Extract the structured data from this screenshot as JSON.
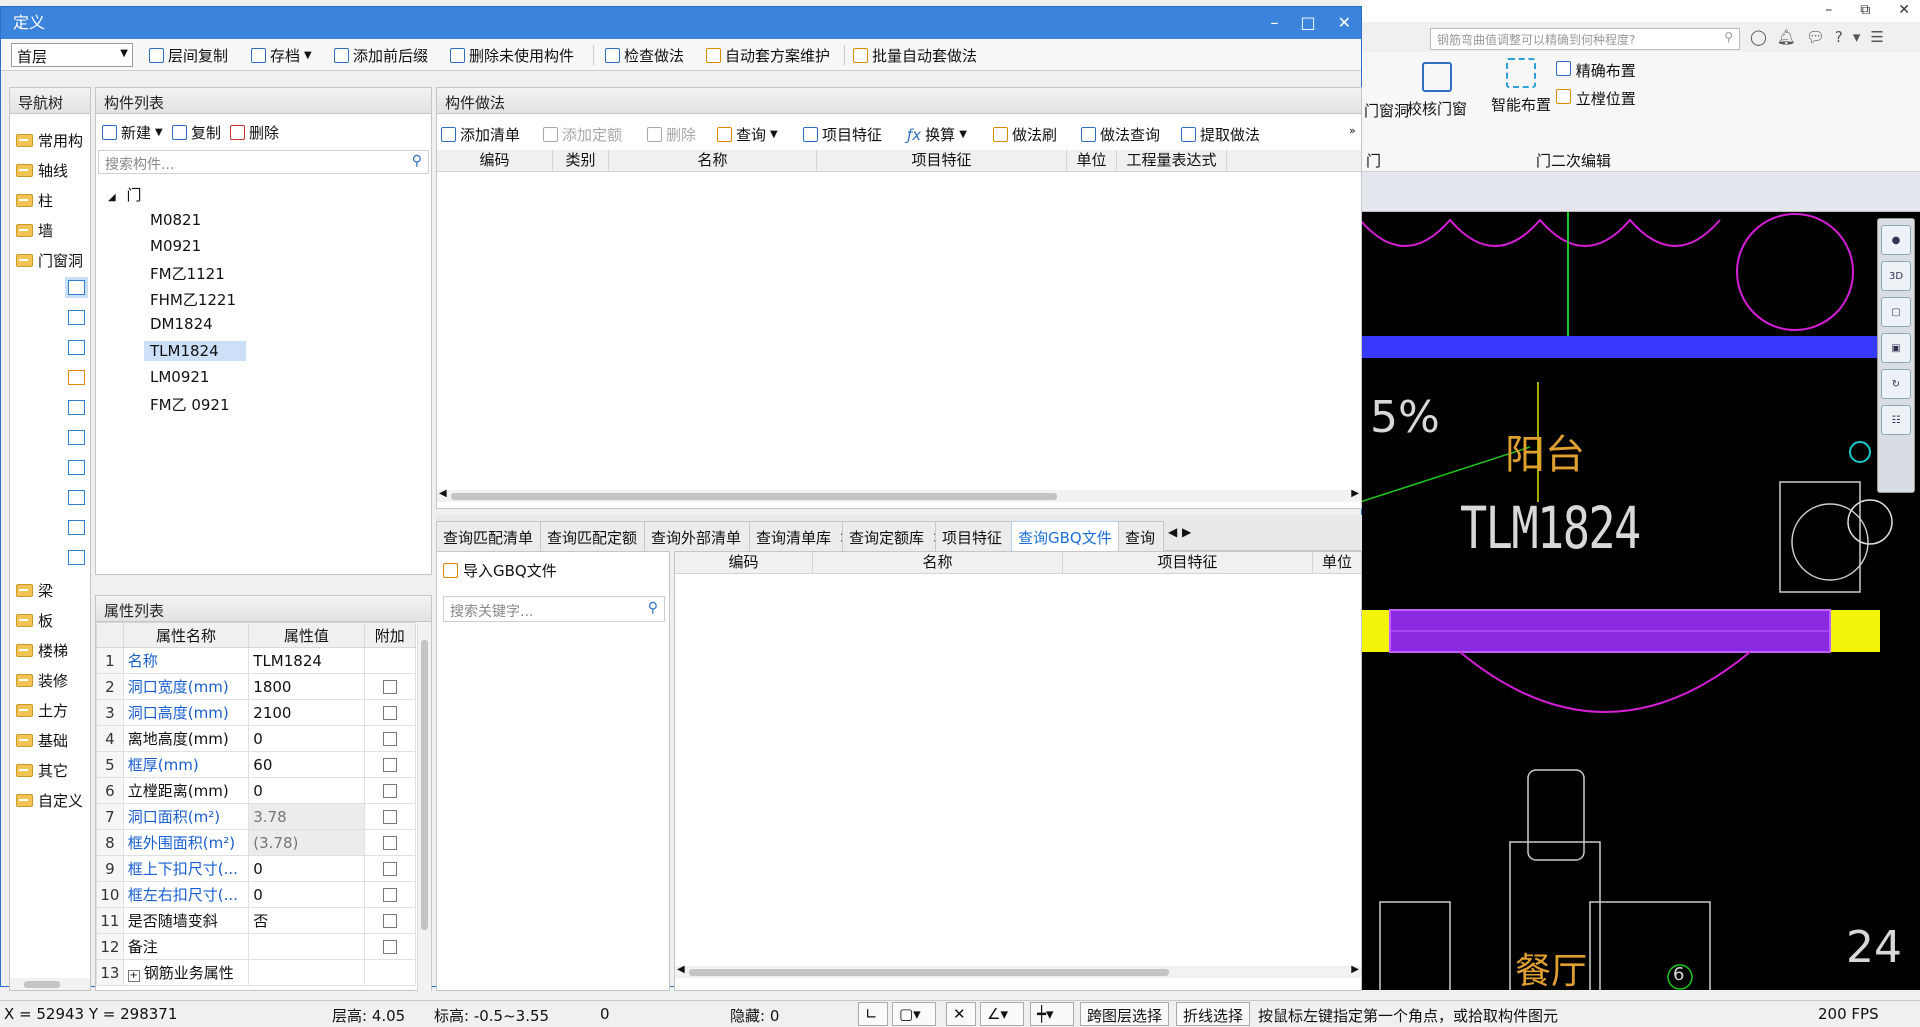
{
  "background_app": {
    "search_placeholder": "钢筋弯曲值调整可以精确到何种程度?",
    "win_controls": [
      "–",
      "⧉",
      "✕"
    ],
    "ribbon": {
      "door_window_label": "门窗洞",
      "check_door_window": "校核门窗",
      "smart_layout": "智能布置",
      "precise_layout": "精确布置",
      "frame_position": "立樘位置",
      "group_label_left": "门",
      "group_label": "门二次编辑"
    },
    "cad": {
      "label_balcony": "阳台",
      "label_door": "TLM1824",
      "label_living": "餐厅",
      "label_percent": "5%",
      "label_axis": "6",
      "label_right": "24"
    }
  },
  "dialog": {
    "title": "定义",
    "controls": [
      "–",
      "□",
      "✕"
    ],
    "toolbar": {
      "floor": "首层",
      "copy_between_floors": "层间复制",
      "save": "存档",
      "add_prefix_suffix": "添加前后缀",
      "delete_unused": "删除未使用构件",
      "check_method": "检查做法",
      "auto_scheme": "自动套方案维护",
      "batch_auto": "批量自动套做法"
    },
    "nav": {
      "title": "导航树",
      "items": [
        "常用构",
        "轴线",
        "柱",
        "墙",
        "门窗洞",
        "梁",
        "板",
        "楼梯",
        "装修",
        "土方",
        "基础",
        "其它",
        "自定义"
      ]
    },
    "component_list": {
      "title": "构件列表",
      "new": "新建",
      "copy": "复制",
      "delete": "删除",
      "search_placeholder": "搜索构件...",
      "root": "门",
      "items": [
        "M0821",
        "M0921",
        "FM乙1121",
        "FHM乙1221",
        "DM1824",
        "TLM1824",
        "LM0921",
        "FM乙 0921"
      ],
      "selected": "TLM1824"
    },
    "property_list": {
      "title": "属性列表",
      "columns": [
        "属性名称",
        "属性值",
        "附加"
      ],
      "rows": [
        {
          "n": "1",
          "name": "名称",
          "value": "TLM1824",
          "blue": true,
          "check": false
        },
        {
          "n": "2",
          "name": "洞口宽度(mm)",
          "value": "1800",
          "blue": true,
          "check": true
        },
        {
          "n": "3",
          "name": "洞口高度(mm)",
          "value": "2100",
          "blue": true,
          "check": true
        },
        {
          "n": "4",
          "name": "离地高度(mm)",
          "value": "0",
          "blue": false,
          "check": true
        },
        {
          "n": "5",
          "name": "框厚(mm)",
          "value": "60",
          "blue": true,
          "check": true
        },
        {
          "n": "6",
          "name": "立樘距离(mm)",
          "value": "0",
          "blue": false,
          "check": true
        },
        {
          "n": "7",
          "name": "洞口面积(m²)",
          "value": "3.78",
          "blue": true,
          "check": true,
          "ro": true
        },
        {
          "n": "8",
          "name": "框外围面积(m²)",
          "value": "(3.78)",
          "blue": true,
          "check": true,
          "ro": true
        },
        {
          "n": "9",
          "name": "框上下扣尺寸(...",
          "value": "0",
          "blue": true,
          "check": true
        },
        {
          "n": "10",
          "name": "框左右扣尺寸(...",
          "value": "0",
          "blue": true,
          "check": true
        },
        {
          "n": "11",
          "name": "是否随墙变斜",
          "value": "否",
          "blue": false,
          "check": true
        },
        {
          "n": "12",
          "name": "备注",
          "value": "",
          "blue": false,
          "check": true
        },
        {
          "n": "13",
          "name": "钢筋业务属性",
          "value": "",
          "blue": false,
          "check": false,
          "expand": true
        }
      ]
    },
    "method": {
      "title": "构件做法",
      "add_list": "添加清单",
      "add_quota": "添加定额",
      "delete": "删除",
      "query": "查询",
      "item_feature": "项目特征",
      "convert": "换算",
      "method_brush": "做法刷",
      "method_query": "做法查询",
      "extract_method": "提取做法",
      "columns": [
        "编码",
        "类别",
        "名称",
        "项目特征",
        "单位",
        "工程量表达式"
      ]
    },
    "query_tabs": [
      {
        "label": "查询匹配清单",
        "active": false
      },
      {
        "label": "查询匹配定额",
        "active": false
      },
      {
        "label": "查询外部清单",
        "active": false
      },
      {
        "label": "查询清单库",
        "active": false
      },
      {
        "label": "查询定额库",
        "active": false
      },
      {
        "label": "项目特征",
        "active": false
      },
      {
        "label": "查询GBQ文件",
        "active": true
      },
      {
        "label": "查询",
        "active": false
      }
    ],
    "query": {
      "import_gbq": "导入GBQ文件",
      "search_placeholder": "搜索关键字...",
      "columns": [
        "编码",
        "名称",
        "项目特征",
        "单位"
      ]
    }
  },
  "statusbar": {
    "coords": "X = 52943 Y = 298371",
    "floor_height": "层高:  4.05",
    "elevation": "标高:  -0.5~3.55",
    "zero": "0",
    "hidden": "隐藏:  0",
    "cross_floor": "跨图层选择",
    "polyline_select": "折线选择",
    "hint": "按鼠标左键指定第一个角点，或拾取构件图元",
    "fps": "200 FPS"
  }
}
